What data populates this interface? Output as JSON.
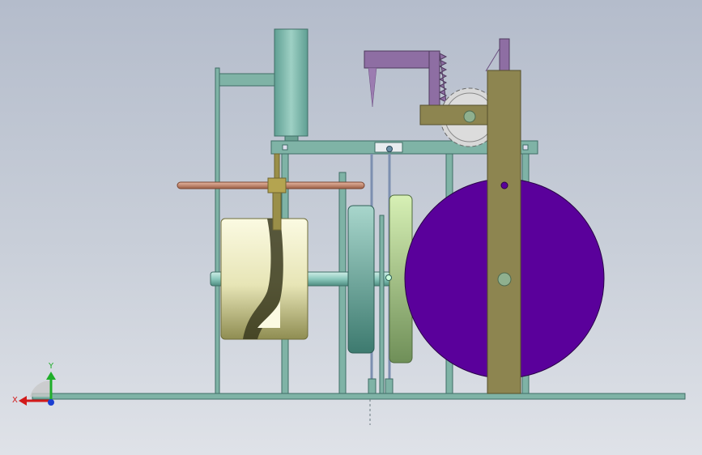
{
  "viewport": {
    "background_top": "#b4bccb",
    "background_bottom": "#dfe2e8"
  },
  "triad": {
    "x_label": "X",
    "y_label": "Y",
    "x_color": "#d21a1a",
    "y_color": "#1fae2a",
    "z_color": "#1a3fd2"
  },
  "colors": {
    "frame": "#7fb3a6",
    "frame_edge": "#3f6e66",
    "column": "#8d8550",
    "flywheel": "#5a009b",
    "cam": "#f1efc6",
    "disc_green": "#bfe0a0",
    "disc_teal": "#6fb0a2",
    "rack": "#8e6ea3",
    "gear": "#d8d8d8",
    "rod_copper": "#c98d6e",
    "cylinder": "#7ab8aa"
  }
}
